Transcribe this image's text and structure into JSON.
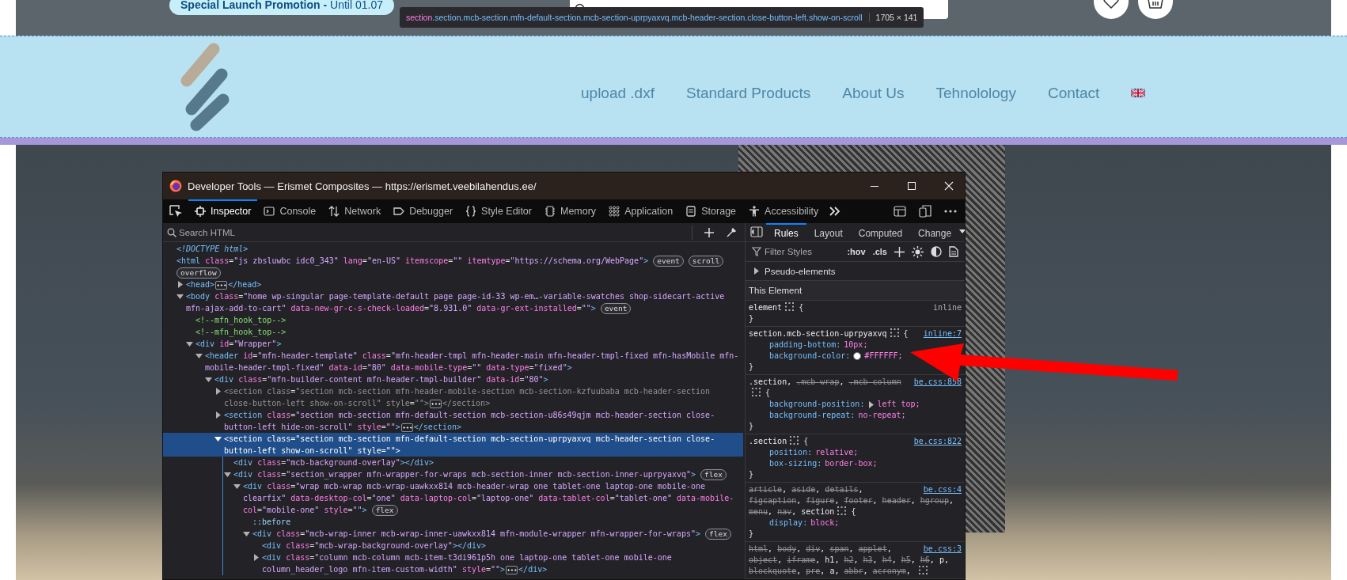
{
  "page": {
    "promo": "**Special Launch Promotion -** Until 01.07",
    "nav": [
      "upload .dxf",
      "Standard Products",
      "About Us",
      "Tehnolology",
      "Contact"
    ],
    "highlight_tooltip": {
      "tag": "section",
      "classes": ".section.mcb-section.mfn-default-section.mcb-section-uprpyaxvq.mcb-header-section.close-button-left.show-on-scroll",
      "size": "1705 × 141"
    }
  },
  "devtools": {
    "title": "Developer Tools — Erismet Composites — https://erismet.veebilahendus.ee/",
    "tabs": [
      {
        "label": "Inspector",
        "kind": "inspector",
        "selected": true
      },
      {
        "label": "Console",
        "kind": "console",
        "selected": false
      },
      {
        "label": "Network",
        "kind": "network",
        "selected": false
      },
      {
        "label": "Debugger",
        "kind": "debugger",
        "selected": false
      },
      {
        "label": "Style Editor",
        "kind": "style",
        "selected": false
      },
      {
        "label": "Memory",
        "kind": "memory",
        "selected": false
      },
      {
        "label": "Application",
        "kind": "application",
        "selected": false
      },
      {
        "label": "Storage",
        "kind": "storage",
        "selected": false
      },
      {
        "label": "Accessibility",
        "kind": "accessibility",
        "selected": false
      }
    ],
    "search": {
      "placeholder": "Search HTML"
    },
    "tree": [
      {
        "kind": "doctype",
        "text": "<!DOCTYPE html>",
        "selected": false
      },
      {
        "kind": "element",
        "text": "<html class=\"js zbsluwbc idc0_343\" lang=\"en-US\" itemscope=\"\" itemtype=\"https://schema.org/WebPage\">",
        "badges": [
          "event",
          "scroll",
          "overflow"
        ],
        "selected": false,
        "children": [
          {
            "kind": "element",
            "text": "<head>",
            "expanded": false,
            "collapsed_content": true,
            "close": "</head>",
            "selected": false
          },
          {
            "kind": "element",
            "text": "<body class=\"home wp-singular page-template-default page page-id-33 wp-em…-variable-swatches shop-sidecart-active mfn-ajax-add-to-cart\" data-new-gr-c-s-check-loaded=\"8.931.0\" data-gr-ext-installed=\"\">",
            "badges": [
              "event"
            ],
            "expanded": true,
            "selected": false,
            "children": [
              {
                "kind": "comment",
                "text": "<!--mfn_hook_top-->",
                "selected": false
              },
              {
                "kind": "comment",
                "text": "<!--mfn_hook_top-->",
                "selected": false
              },
              {
                "kind": "element",
                "text": "<div id=\"Wrapper\">",
                "expanded": true,
                "selected": false,
                "children": [
                  {
                    "kind": "element",
                    "text": "<header id=\"mfn-header-template\" class=\"mfn-header-tmpl mfn-header-main mfn-header-tmpl-fixed mfn-hasMobile mfn-mobile-header-tmpl-fixed\" data-id=\"80\" data-mobile-type=\"\" data-type=\"fixed\">",
                    "expanded": true,
                    "selected": false,
                    "children": [
                      {
                        "kind": "element",
                        "text": "<div class=\"mfn-builder-content mfn-header-tmpl-builder\" data-id=\"80\">",
                        "expanded": true,
                        "selected": false,
                        "children": [
                          {
                            "kind": "element",
                            "text": "<section class=\"section mcb-section mfn-header-mobile-section mcb-section-kzfuubaba mcb-header-section close-button-left show-on-scroll\" style=\"\">",
                            "expanded": false,
                            "collapsed_content": true,
                            "close": "</section>",
                            "hidden": true,
                            "selected": false
                          },
                          {
                            "kind": "element",
                            "text": "<section class=\"section mcb-section mfn-default-section mcb-section-u86s49qjm mcb-header-section close-button-left hide-on-scroll\" style=\"\">",
                            "expanded": false,
                            "collapsed_content": true,
                            "close": "</section>",
                            "hidden": false,
                            "selected": false
                          },
                          {
                            "kind": "element",
                            "text": "<section class=\"section mcb-section mfn-default-section mcb-section-uprpyaxvq mcb-header-section close-button-left show-on-scroll\" style=\"\">",
                            "expanded": true,
                            "hidden": false,
                            "selected": true,
                            "children": [
                              {
                                "kind": "element",
                                "text": "<div class=\"mcb-background-overlay\"></div>",
                                "selected": false
                              },
                              {
                                "kind": "element",
                                "text": "<div class=\"section_wrapper mfn-wrapper-for-wraps mcb-section-inner mcb-section-inner-uprpyaxvq\">",
                                "badges": [
                                  "flex"
                                ],
                                "expanded": true,
                                "selected": false,
                                "children": [
                                  {
                                    "kind": "element",
                                    "text": "<div class=\"wrap mcb-wrap mcb-wrap-uawkxx814 mcb-header-wrap one tablet-one laptop-one mobile-one clearfix\" data-desktop-col=\"one\" data-laptop-col=\"laptop-one\" data-tablet-col=\"tablet-one\" data-mobile-col=\"mobile-one\" style=\"\">",
                                    "badges": [
                                      "flex"
                                    ],
                                    "expanded": true,
                                    "selected": false,
                                    "children": [
                                      {
                                        "kind": "pseudo",
                                        "text": "::before",
                                        "selected": false
                                      },
                                      {
                                        "kind": "element",
                                        "text": "<div class=\"mcb-wrap-inner mcb-wrap-inner-uawkxx814 mfn-module-wrapper mfn-wrapper-for-wraps\">",
                                        "badges": [
                                          "flex"
                                        ],
                                        "expanded": true,
                                        "selected": false,
                                        "children": [
                                          {
                                            "kind": "element",
                                            "text": "<div class=\"mcb-wrap-background-overlay\"></div>",
                                            "selected": false
                                          },
                                          {
                                            "kind": "element",
                                            "text": "<div class=\"column mcb-column mcb-item-t3di961p5h one laptop-one tablet-one mobile-one column_header_logo mfn-item-custom-width\" style=\"\">",
                                            "expanded": false,
                                            "collapsed_content": true,
                                            "close": "</div>",
                                            "selected": false
                                          }
                                        ]
                                      }
                                    ]
                                  }
                                ]
                              }
                            ]
                          }
                        ]
                      }
                    ]
                  }
                ]
              }
            ]
          }
        ]
      }
    ],
    "rules_panel": {
      "tabs": [
        {
          "label": "Rules",
          "selected": true
        },
        {
          "label": "Layout",
          "selected": false
        },
        {
          "label": "Computed",
          "selected": false
        },
        {
          "label": "Change",
          "selected": false
        }
      ],
      "filter": {
        "placeholder": "Filter Styles"
      },
      "buttons": [
        ":hov",
        ".cls"
      ],
      "pseudo_elements": {
        "label": "Pseudo-elements",
        "expanded": false
      },
      "section_header": "This Element",
      "rules": [
        {
          "selector": [
            {
              "text": "element",
              "struck": false
            }
          ],
          "open": "{",
          "close": "}",
          "source": "inline",
          "source_link": false
        },
        {
          "selector": [
            {
              "text": "section.mcb-section-uprpyaxvq",
              "struck": false
            }
          ],
          "open": "{",
          "close": "}",
          "source": "inline:7",
          "source_link": true,
          "declarations": [
            {
              "property": "padding-bottom:",
              "value": "10px;"
            },
            {
              "property": "background-color:",
              "value": "#FFFFFF;",
              "color": "#ffffff"
            }
          ]
        },
        {
          "selector": [
            {
              "text": ".section",
              "struck": false,
              "sep": ","
            },
            {
              "text": ".mcb-wrap",
              "struck": true,
              "sep": ","
            },
            {
              "text": ".mcb-column",
              "struck": true
            }
          ],
          "open": "{",
          "close": "}",
          "source": "be.css:858",
          "source_link": true,
          "declarations": [
            {
              "property": "background-position:",
              "value": "left top;",
              "expandable": true
            },
            {
              "property": "background-repeat:",
              "value": "no-repeat;"
            }
          ]
        },
        {
          "selector": [
            {
              "text": ".section",
              "struck": false
            }
          ],
          "open": "{",
          "close": "}",
          "source": "be.css:822",
          "source_link": true,
          "declarations": [
            {
              "property": "position:",
              "value": "relative;"
            },
            {
              "property": "box-sizing:",
              "value": "border-box;"
            }
          ]
        },
        {
          "selector": [
            {
              "text": "article",
              "struck": true,
              "sep": ","
            },
            {
              "text": "aside",
              "struck": true,
              "sep": ","
            },
            {
              "text": "details",
              "struck": true,
              "sep": ","
            },
            {
              "text": "figcaption",
              "struck": true,
              "sep": ","
            },
            {
              "text": "figure",
              "struck": true,
              "sep": ","
            },
            {
              "text": "footer",
              "struck": true,
              "sep": ","
            },
            {
              "text": "header",
              "struck": true,
              "sep": ","
            },
            {
              "text": "hgroup",
              "struck": true,
              "sep": ","
            },
            {
              "text": "menu",
              "struck": true,
              "sep": ","
            },
            {
              "text": "nav",
              "struck": true,
              "sep": ","
            },
            {
              "text": "section",
              "struck": false
            }
          ],
          "open": "{",
          "close": "}",
          "source": "be.css:4",
          "source_link": true,
          "declarations": [
            {
              "property": "display:",
              "value": "block;"
            }
          ]
        },
        {
          "selector": [
            {
              "text": "html",
              "struck": true,
              "sep": ","
            },
            {
              "text": "body",
              "struck": true,
              "sep": ","
            },
            {
              "text": "div",
              "struck": true,
              "sep": ","
            },
            {
              "text": "span",
              "struck": true,
              "sep": ","
            },
            {
              "text": "applet",
              "struck": true,
              "sep": ","
            },
            {
              "text": "object",
              "struck": true,
              "sep": ","
            },
            {
              "text": "iframe",
              "struck": true,
              "sep": ","
            },
            {
              "text": "h1",
              "struck": false,
              "sep": ","
            },
            {
              "text": "h2",
              "struck": true,
              "sep": ","
            },
            {
              "text": "h3",
              "struck": true,
              "sep": ","
            },
            {
              "text": "h4",
              "struck": true,
              "sep": ","
            },
            {
              "text": "h5",
              "struck": true,
              "sep": ","
            },
            {
              "text": "h6",
              "struck": true,
              "sep": ","
            },
            {
              "text": "p",
              "struck": false,
              "sep": ","
            },
            {
              "text": "blockquote",
              "struck": true,
              "sep": ","
            },
            {
              "text": "pre",
              "struck": true,
              "sep": ","
            },
            {
              "text": "a",
              "struck": false,
              "sep": ","
            },
            {
              "text": "abbr",
              "struck": true,
              "sep": ","
            },
            {
              "text": "acronym",
              "struck": true,
              "sep": ","
            }
          ],
          "source": "be.css:3",
          "source_link": true
        }
      ]
    }
  }
}
